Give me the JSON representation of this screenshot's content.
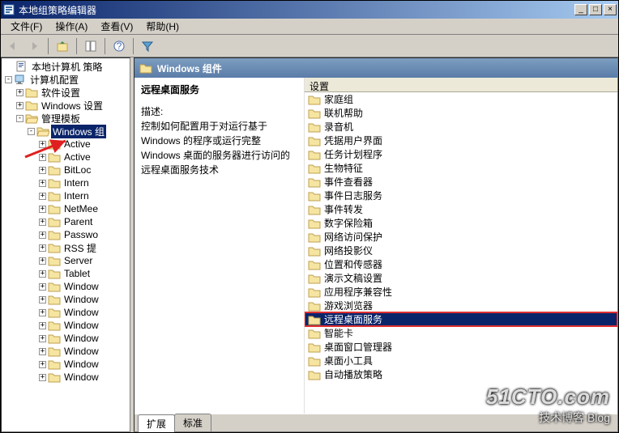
{
  "window": {
    "title": "本地组策略编辑器",
    "buttons": {
      "min": "_",
      "max": "□",
      "close": "×"
    }
  },
  "menu": {
    "file": "文件(F)",
    "action": "操作(A)",
    "view": "查看(V)",
    "help": "帮助(H)"
  },
  "tree": {
    "root": "本地计算机 策略",
    "computer_config": "计算机配置",
    "software": "软件设置",
    "windows_settings": "Windows 设置",
    "admin_templates": "管理模板",
    "windows_components": "Windows 组",
    "items": [
      "Active",
      "Active",
      "BitLoc",
      "Intern",
      "Intern",
      "NetMee",
      "Parent",
      "Passwo",
      "RSS 提",
      "Server",
      "Tablet",
      "Window",
      "Window",
      "Window",
      "Window",
      "Window",
      "Window",
      "Window",
      "Window"
    ]
  },
  "header": {
    "title": "Windows 组件"
  },
  "leftpane": {
    "heading": "远程桌面服务",
    "desc_label": "描述:",
    "desc": "控制如何配置用于对运行基于 Windows 的程序或运行完整 Windows 桌面的服务器进行访问的远程桌面服务技术"
  },
  "list": {
    "header": "设置",
    "items": [
      "家庭组",
      "联机帮助",
      "录音机",
      "凭据用户界面",
      "任务计划程序",
      "生物特征",
      "事件查看器",
      "事件日志服务",
      "事件转发",
      "数字保险箱",
      "网络访问保护",
      "网络投影仪",
      "位置和传感器",
      "演示文稿设置",
      "应用程序兼容性",
      "游戏浏览器",
      "远程桌面服务",
      "智能卡",
      "桌面窗口管理器",
      "桌面小工具",
      "自动播放策略"
    ],
    "selected_index": 16
  },
  "tabs": {
    "extended": "扩展",
    "standard": "标准"
  },
  "watermark": {
    "line1": "51CTO.com",
    "line2": "技术博客  Blog"
  }
}
